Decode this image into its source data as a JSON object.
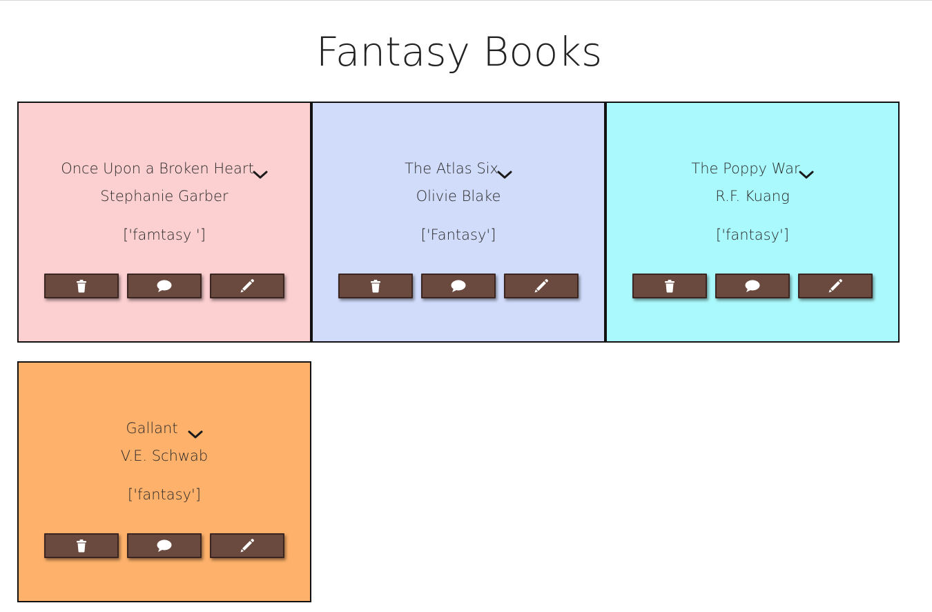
{
  "page": {
    "title": "Fantasy Books"
  },
  "books": [
    {
      "title": "Once Upon a Broken Heart",
      "author": "Stephanie Garber",
      "genres": "['famtasy ']",
      "color": "#fccfd1"
    },
    {
      "title": "The Atlas Six",
      "author": "Olivie Blake",
      "genres": "['Fantasy']",
      "color": "#d1dcfb"
    },
    {
      "title": "The Poppy War",
      "author": "R.F. Kuang",
      "genres": "['fantasy']",
      "color": "#aafafd"
    },
    {
      "title": "Gallant",
      "author": "V.E. Schwab",
      "genres": "['fantasy']",
      "color": "#feb16b"
    }
  ],
  "icons": {
    "delete": "trash-icon",
    "comment": "comment-icon",
    "edit": "pencil-icon",
    "expand": "chevron-down-icon"
  },
  "colors": {
    "button_bg": "#6a4a3f",
    "button_border": "#3a2520",
    "text": "#2a2a2a"
  }
}
